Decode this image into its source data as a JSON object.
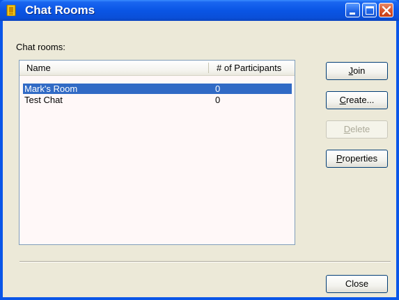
{
  "window": {
    "title": "Chat Rooms",
    "controls": {
      "minimize_icon": "minimize-icon",
      "maximize_icon": "maximize-icon",
      "close_icon": "close-icon"
    }
  },
  "main": {
    "list_label": "Chat rooms:",
    "columns": [
      "Name",
      "# of Participants"
    ],
    "rooms": [
      {
        "name": "Mark's Room",
        "participants": "0",
        "selected": true
      },
      {
        "name": "Test Chat",
        "participants": "0",
        "selected": false
      }
    ]
  },
  "buttons": {
    "join": {
      "mnemonic": "J",
      "rest": "oin"
    },
    "create": {
      "mnemonic": "C",
      "rest": "reate..."
    },
    "delete": {
      "mnemonic": "D",
      "rest": "elete"
    },
    "properties": {
      "mnemonic": "P",
      "rest": "roperties"
    },
    "close": "Close"
  },
  "colors": {
    "titlebar": "#0a55e5",
    "selection": "#316ac5",
    "face": "#ece9d8"
  }
}
